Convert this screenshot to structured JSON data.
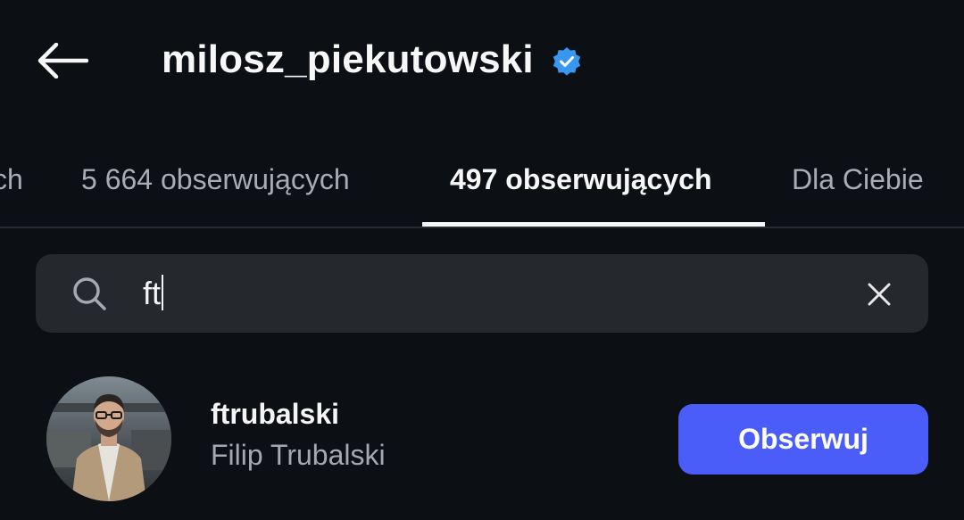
{
  "header": {
    "back_icon": "arrow-left-icon",
    "username": "milosz_piekutowski",
    "verified_icon": "verified-badge-icon",
    "verified_color": "#3897f0"
  },
  "tabs": [
    {
      "label": "ch",
      "active": false
    },
    {
      "label": "5 664 obserwujących",
      "active": false
    },
    {
      "label": "497 obserwujących",
      "active": true
    },
    {
      "label": "Dla Ciebie",
      "active": false
    }
  ],
  "search": {
    "icon": "search-icon",
    "value": "ft",
    "clear_icon": "close-icon"
  },
  "results": [
    {
      "username": "ftrubalski",
      "full_name": "Filip Trubalski",
      "button_label": "Obserwuj",
      "button_color": "#4a5df9"
    }
  ],
  "colors": {
    "background": "#0c0f14",
    "search_bg": "#25282d",
    "text_primary": "#f5f5f5",
    "text_secondary": "#a5a8ae"
  }
}
